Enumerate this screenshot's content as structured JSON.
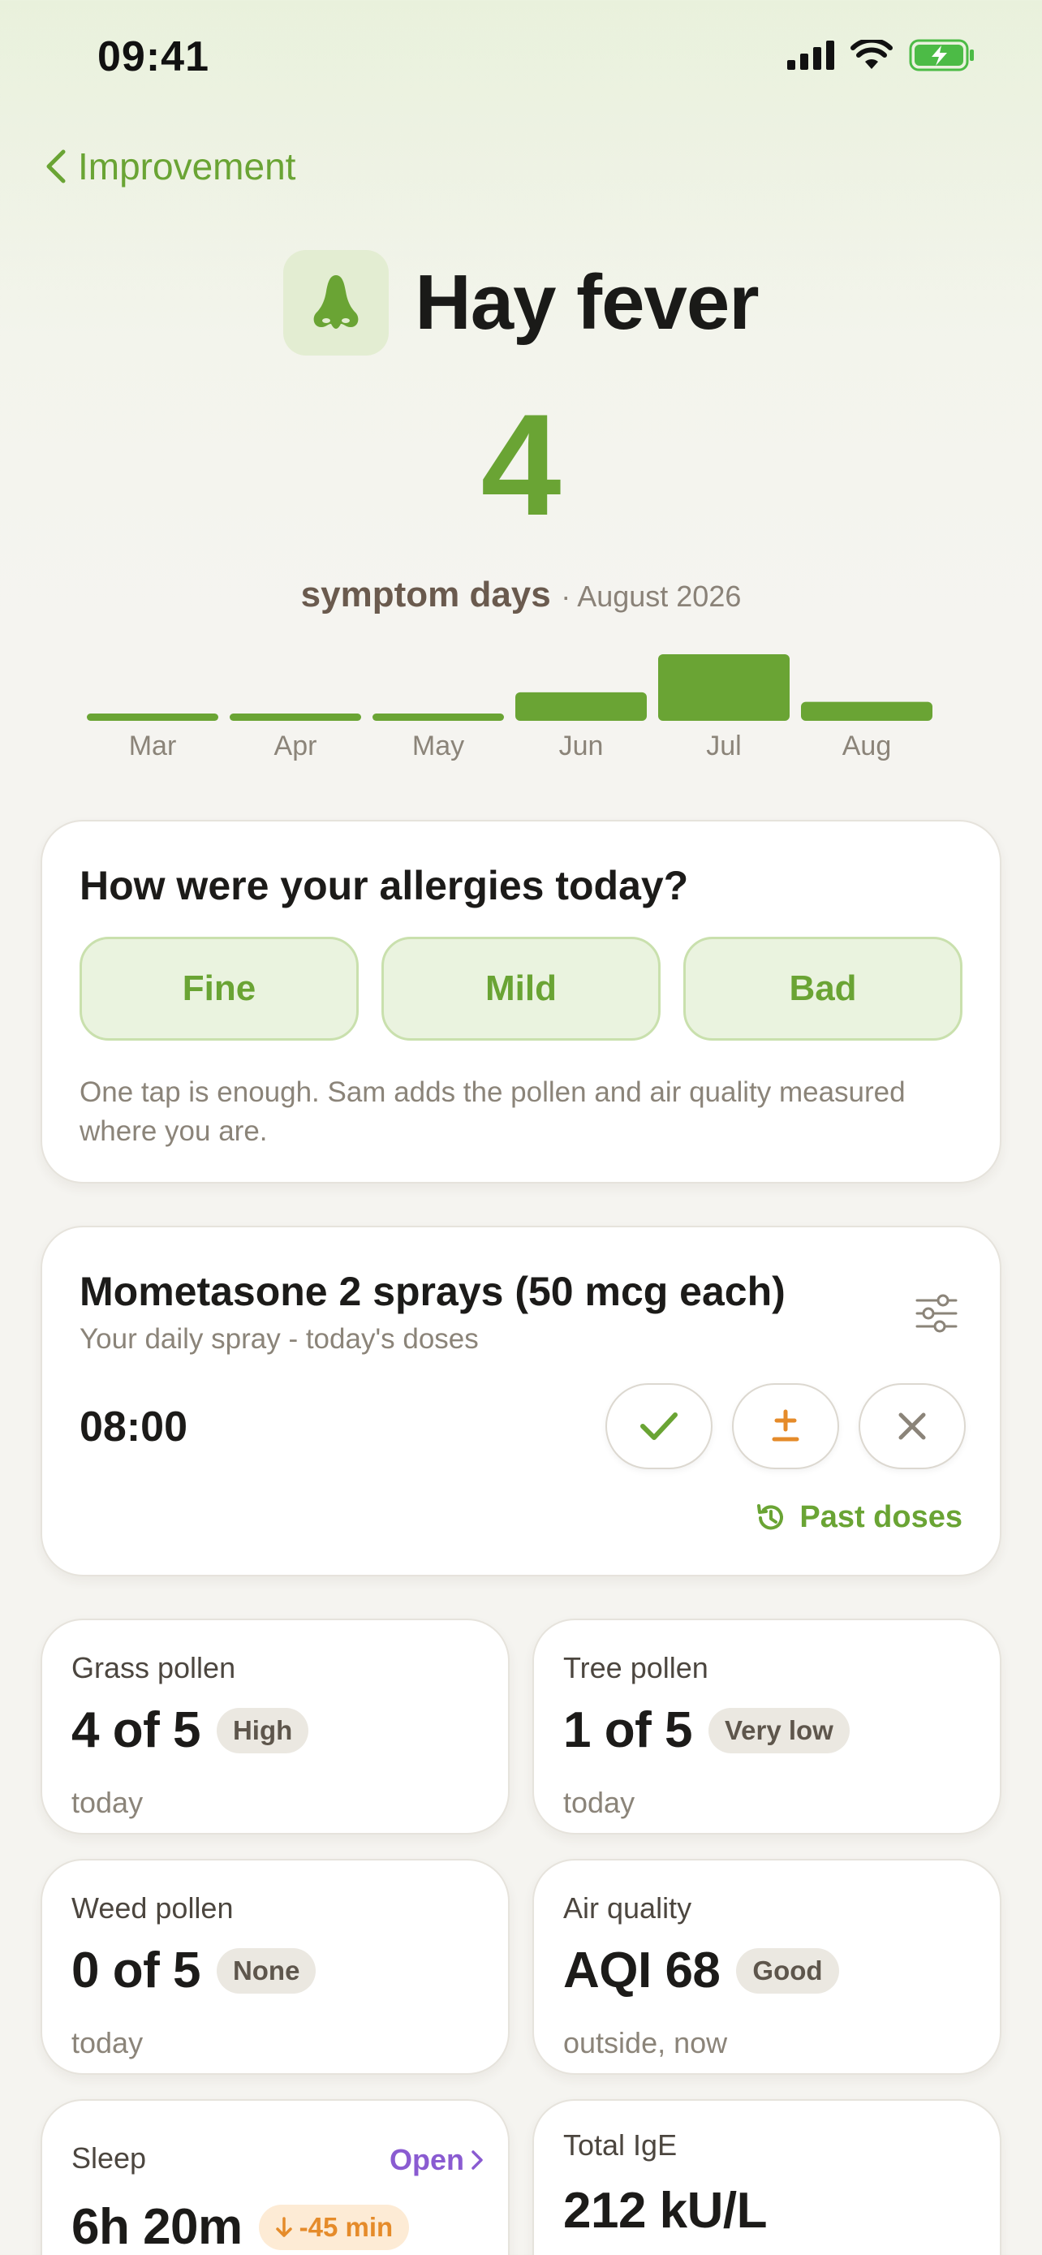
{
  "status_bar": {
    "time": "09:41"
  },
  "nav": {
    "back_label": "Improvement"
  },
  "header": {
    "title": "Hay fever",
    "icon": "nose-icon"
  },
  "summary": {
    "count": "4",
    "unit": "symptom days",
    "period": "· August 2026"
  },
  "chart_data": {
    "type": "bar",
    "title": "",
    "categories": [
      "Mar",
      "Apr",
      "May",
      "Jun",
      "Jul",
      "Aug"
    ],
    "values": [
      0,
      0,
      0,
      3,
      7,
      2
    ],
    "ylim": [
      0,
      7
    ],
    "grid": false,
    "bar_color": "#6aa434"
  },
  "checkin": {
    "question": "How were your allergies today?",
    "options": [
      "Fine",
      "Mild",
      "Bad"
    ],
    "note": "One tap is enough. Sam adds the pollen and air quality measured where you are."
  },
  "medication": {
    "title": "Mometasone 2 sprays (50 mcg each)",
    "subtitle": "Your daily spray - today's doses",
    "dose_time": "08:00",
    "actions": [
      "check-icon",
      "plus-minus-icon",
      "close-icon"
    ],
    "past_doses_label": "Past doses"
  },
  "metrics": [
    {
      "label": "Grass pollen",
      "value": "4 of 5",
      "badge": "High",
      "foot": "today"
    },
    {
      "label": "Tree pollen",
      "value": "1 of 5",
      "badge": "Very low",
      "foot": "today"
    },
    {
      "label": "Weed pollen",
      "value": "0 of 5",
      "badge": "None",
      "foot": "today"
    },
    {
      "label": "Air quality",
      "value": "AQI 68",
      "badge": "Good",
      "foot": "outside, now"
    },
    {
      "label": "Sleep",
      "value": "6h 20m",
      "badge": "-45 min",
      "link": "Open"
    },
    {
      "label": "Total IgE",
      "value": "212 kU/L"
    }
  ],
  "colors": {
    "accent": "#6aa434",
    "link_purple": "#8a5bd1",
    "warning_orange": "#e58b2a"
  }
}
